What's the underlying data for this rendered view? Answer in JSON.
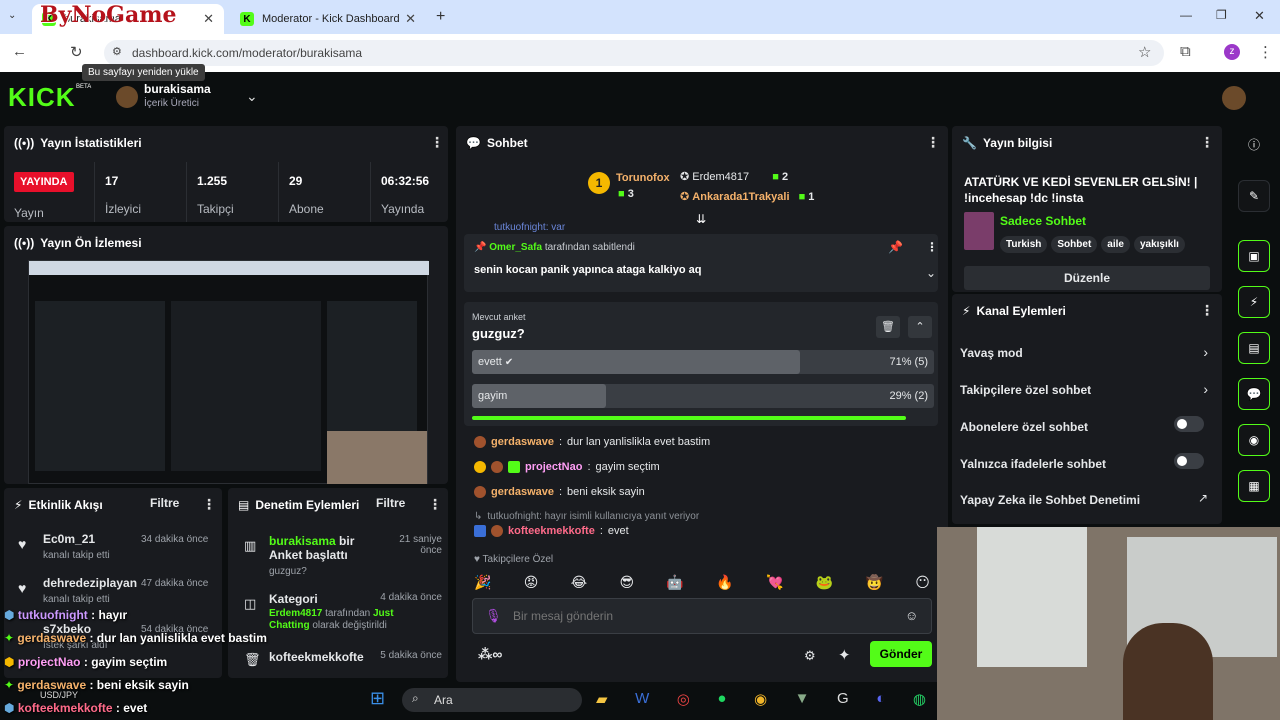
{
  "browser": {
    "tabs": [
      {
        "label": "burakisama",
        "active": true
      },
      {
        "label": "Moderator - Kick Dashboard",
        "active": false
      }
    ],
    "overlay_logo": "ByNoGame",
    "url": "dashboard.kick.com/moderator/burakisama",
    "tooltip": "Bu sayfayı yeniden yükle",
    "profile_initial": "z"
  },
  "header": {
    "logo": "KICK",
    "beta": "BETA",
    "username": "burakisama",
    "role": "İçerik Üretici"
  },
  "stats": {
    "title": "Yayın İstatistikleri",
    "live_badge": "YAYINDA",
    "status_label": "Yayın",
    "items": [
      {
        "value": "17",
        "label": "İzleyici"
      },
      {
        "value": "1.255",
        "label": "Takipçi"
      },
      {
        "value": "29",
        "label": "Abone"
      },
      {
        "value": "06:32:56",
        "label": "Yayında"
      }
    ]
  },
  "preview": {
    "title": "Yayın Ön İzlemesi"
  },
  "activity": {
    "title": "Etkinlik Akışı",
    "filter": "Filtre",
    "items": [
      {
        "user": "Ec0m_21",
        "time": "34 dakika önce",
        "desc": "kanalı takip etti"
      },
      {
        "user": "dehredeziplayan",
        "time": "47 dakika önce",
        "desc": "kanalı takip etti"
      },
      {
        "user": "s7xbeko",
        "time": "54 dakika önce",
        "desc": "İstek şarkı aldı"
      }
    ]
  },
  "moderation": {
    "title": "Denetim Eylemleri",
    "filter": "Filtre",
    "items": [
      {
        "user": "burakisama",
        "action": "bir Anket başlattı",
        "time": "21 saniye önce",
        "detail": "guzguz?"
      },
      {
        "user": "Kategori",
        "time": "4 dakika önce",
        "detail_user": "Erdem4817",
        "detail_mid": "tarafından",
        "detail_cat": "Just Chatting",
        "detail_end": "olarak değiştirildi"
      },
      {
        "user": "kofteekmekkofte",
        "time": "5 dakika önce"
      }
    ]
  },
  "chat": {
    "title": "Sohbet",
    "leaders": [
      {
        "rank": "1",
        "name": "Torunofox",
        "count": "3"
      },
      {
        "name": "Erdem4817",
        "count": "2"
      },
      {
        "name": "Ankarada1Trakyali",
        "count": "1"
      }
    ],
    "hidden_line": "tutkuofnight: var",
    "pinned": {
      "user": "Omer_Safa",
      "suffix": "tarafından sabitlendi",
      "message": "senin kocan panik yapınca ataga kalkiyo aq"
    },
    "poll": {
      "label": "Mevcut anket",
      "question": "guzguz?",
      "options": [
        {
          "text": "evett",
          "pct_label": "71% (5)",
          "fraction": 0.71
        },
        {
          "text": "gayim",
          "pct_label": "29% (2)",
          "fraction": 0.29
        }
      ]
    },
    "messages": [
      {
        "user": "gerdaswave",
        "text": "dur lan yanlislikla evet bastim",
        "color": "#f5b26b"
      },
      {
        "user": "projectNao",
        "text": "gayim seçtim",
        "color": "#ff9ef5"
      },
      {
        "user": "gerdaswave",
        "text": "beni eksik sayin",
        "color": "#f5b26b"
      }
    ],
    "reply_info": "tutkuofnight: hayır isimli kullanıcıya yanıt veriyor",
    "last": {
      "user": "kofteekmekkofte",
      "text": "evet",
      "color": "#ff6b8a"
    },
    "emote_section": "Takipçilere Özel",
    "input_placeholder": "Bir mesaj gönderin",
    "send": "Gönder"
  },
  "info": {
    "title": "Yayın bilgisi",
    "stream_title": "ATATÜRK VE KEDİ SEVENLER GELSİN! | !incehesap !dc !insta",
    "category": "Sadece Sohbet",
    "tags": [
      "Turkish",
      "Sohbet",
      "aile",
      "yakışıklı"
    ],
    "edit": "Düzenle"
  },
  "actions": {
    "title": "Kanal Eylemleri",
    "items": [
      {
        "label": "Yavaş mod",
        "kind": "arrow"
      },
      {
        "label": "Takipçilere özel sohbet",
        "kind": "arrow"
      },
      {
        "label": "Abonelere özel sohbet",
        "kind": "toggle"
      },
      {
        "label": "Yalnızca ifadelerle sohbet",
        "kind": "toggle"
      },
      {
        "label": "Yapay Zeka ile Sohbet Denetimi",
        "kind": "link"
      }
    ]
  },
  "overlay_chat": [
    {
      "user": "tutkuofnight",
      "text": "hayır"
    },
    {
      "user": "gerdaswave",
      "text": "dur lan yanlislikla evet bastim"
    },
    {
      "user": "projectNao",
      "text": "gayim seçtim"
    },
    {
      "user": "gerdaswave",
      "text": "beni eksik sayin"
    },
    {
      "user": "kofteekmekkofte",
      "text": "evet"
    }
  ],
  "taskbar": {
    "search": "Ara",
    "ticker": "USD/JPY"
  },
  "colors": {
    "kick_green": "#53fc18",
    "panel": "#191b1f",
    "live_red": "#e8102b"
  }
}
